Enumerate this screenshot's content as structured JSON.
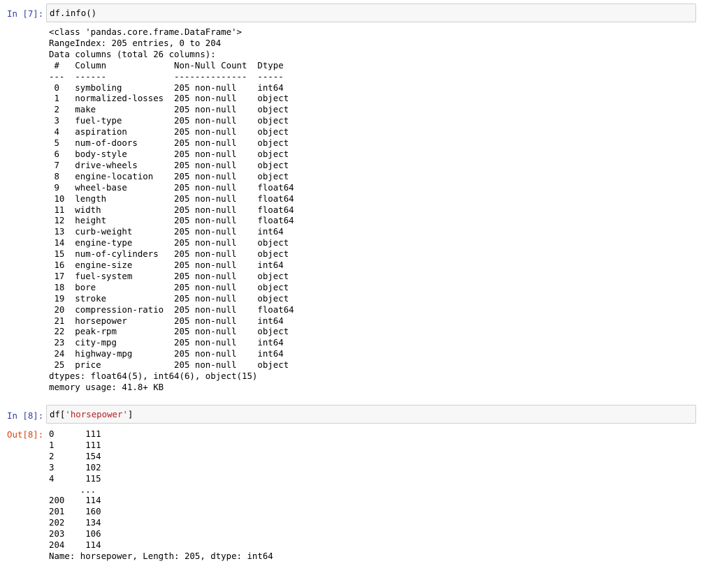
{
  "cells": [
    {
      "prompt": "In [7]:",
      "code": "df.info()",
      "output_lines": [
        "<class 'pandas.core.frame.DataFrame'>",
        "RangeIndex: 205 entries, 0 to 204",
        "Data columns (total 26 columns):",
        " #   Column             Non-Null Count  Dtype  ",
        "---  ------             --------------  -----  ",
        " 0   symboling          205 non-null    int64  ",
        " 1   normalized-losses  205 non-null    object ",
        " 2   make               205 non-null    object ",
        " 3   fuel-type          205 non-null    object ",
        " 4   aspiration         205 non-null    object ",
        " 5   num-of-doors       205 non-null    object ",
        " 6   body-style         205 non-null    object ",
        " 7   drive-wheels       205 non-null    object ",
        " 8   engine-location    205 non-null    object ",
        " 9   wheel-base         205 non-null    float64",
        " 10  length             205 non-null    float64",
        " 11  width              205 non-null    float64",
        " 12  height             205 non-null    float64",
        " 13  curb-weight        205 non-null    int64  ",
        " 14  engine-type        205 non-null    object ",
        " 15  num-of-cylinders   205 non-null    object ",
        " 16  engine-size        205 non-null    int64  ",
        " 17  fuel-system        205 non-null    object ",
        " 18  bore               205 non-null    object ",
        " 19  stroke             205 non-null    object ",
        " 20  compression-ratio  205 non-null    float64",
        " 21  horsepower         205 non-null    int64  ",
        " 22  peak-rpm           205 non-null    object ",
        " 23  city-mpg           205 non-null    int64  ",
        " 24  highway-mpg        205 non-null    int64  ",
        " 25  price              205 non-null    object ",
        "dtypes: float64(5), int64(6), object(15)",
        "memory usage: 41.8+ KB"
      ]
    },
    {
      "prompt": "In [8]:",
      "code_prefix": "df[",
      "code_string": "'horsepower'",
      "code_suffix": "]",
      "out_prompt": "Out[8]:",
      "output_lines": [
        "0      111",
        "1      111",
        "2      154",
        "3      102",
        "4      115",
        "      ... ",
        "200    114",
        "201    160",
        "202    134",
        "203    106",
        "204    114",
        "Name: horsepower, Length: 205, dtype: int64"
      ]
    }
  ]
}
